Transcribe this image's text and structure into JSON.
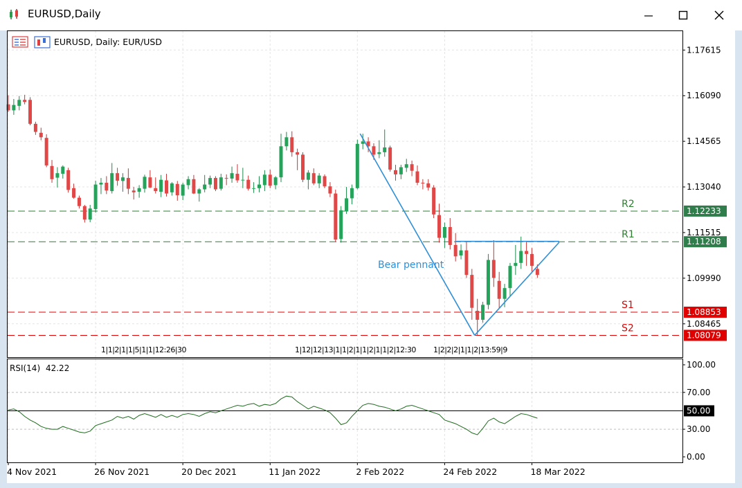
{
  "window": {
    "title": "EURUSD,Daily",
    "icon": "candlestick-app-icon",
    "controls": [
      "minimize-icon",
      "maximize-icon",
      "close-icon"
    ]
  },
  "chart_data": {
    "type": "candlestick",
    "title": "EURUSD, Daily:  EUR/USD",
    "price_axis": {
      "ticks": [
        "1.17615",
        "1.16090",
        "1.14565",
        "1.13040",
        "1.11515",
        "1.09990",
        "1.08465"
      ],
      "range": [
        1.0735,
        1.1827
      ]
    },
    "date_axis": {
      "labels": [
        {
          "text": "4 Nov 2021",
          "index": 0
        },
        {
          "text": "26 Nov 2021",
          "index": 16
        },
        {
          "text": "20 Dec 2021",
          "index": 32
        },
        {
          "text": "11 Jan 2022",
          "index": 48
        },
        {
          "text": "2 Feb 2022",
          "index": 64
        },
        {
          "text": "24 Feb 2022",
          "index": 80
        },
        {
          "text": "18 Mar 2022",
          "index": 96
        }
      ]
    },
    "levels": [
      {
        "name": "R2",
        "value": 1.12233,
        "label": "1.12233",
        "color": "#2e7d32"
      },
      {
        "name": "R1",
        "value": 1.11208,
        "label": "1.11208",
        "color": "#2e7d32"
      },
      {
        "name": "S1",
        "value": 1.08853,
        "label": "1.08853",
        "color": "#e00000"
      },
      {
        "name": "S2",
        "value": 1.08079,
        "label": "1.08079",
        "color": "#e00000"
      }
    ],
    "annotation": {
      "text": "Bear pennant",
      "color": "#2f8fd6",
      "lines": [
        {
          "from": [
            64.5,
            1.1482
          ],
          "to": [
            85.5,
            1.0808
          ]
        },
        {
          "from": [
            85.5,
            1.0808
          ],
          "to": [
            101,
            1.1119
          ]
        },
        {
          "from": [
            82,
            1.1122
          ],
          "to": [
            101,
            1.1122
          ]
        }
      ]
    },
    "event_markers": [
      "1|1|2|1|1|5|1|1|12:26|30",
      "1|12|12|13|1|1|2|1|1|2|1|1|2|12:30",
      "1|2|2|2|1|1|2|13:59|9"
    ],
    "candles": [
      [
        1.158,
        1.161,
        1.1555,
        1.156
      ],
      [
        1.156,
        1.1598,
        1.1545,
        1.1578
      ],
      [
        1.1575,
        1.1608,
        1.156,
        1.1595
      ],
      [
        1.1595,
        1.1612,
        1.158,
        1.1588
      ],
      [
        1.1595,
        1.1604,
        1.151,
        1.1515
      ],
      [
        1.1515,
        1.1522,
        1.1478,
        1.1488
      ],
      [
        1.1485,
        1.1502,
        1.146,
        1.147
      ],
      [
        1.1468,
        1.148,
        1.137,
        1.1376
      ],
      [
        1.1374,
        1.1394,
        1.1318,
        1.133
      ],
      [
        1.1335,
        1.137,
        1.1302,
        1.135
      ],
      [
        1.1348,
        1.1376,
        1.1332,
        1.1372
      ],
      [
        1.136,
        1.1368,
        1.1285,
        1.1294
      ],
      [
        1.13,
        1.1315,
        1.1265,
        1.1268
      ],
      [
        1.1268,
        1.1275,
        1.1232,
        1.124
      ],
      [
        1.124,
        1.1244,
        1.1185,
        1.1195
      ],
      [
        1.1195,
        1.1244,
        1.1186,
        1.1232
      ],
      [
        1.123,
        1.1325,
        1.1218,
        1.1312
      ],
      [
        1.1312,
        1.1334,
        1.128,
        1.1318
      ],
      [
        1.1318,
        1.134,
        1.128,
        1.1292
      ],
      [
        1.129,
        1.1384,
        1.1282,
        1.135
      ],
      [
        1.135,
        1.1368,
        1.1308,
        1.1325
      ],
      [
        1.1324,
        1.135,
        1.1288,
        1.1336
      ],
      [
        1.1334,
        1.1366,
        1.128,
        1.1298
      ],
      [
        1.1292,
        1.1304,
        1.1262,
        1.1286
      ],
      [
        1.1288,
        1.131,
        1.1268,
        1.13
      ],
      [
        1.1298,
        1.1345,
        1.1285,
        1.1338
      ],
      [
        1.1336,
        1.136,
        1.13,
        1.1302
      ],
      [
        1.13,
        1.1336,
        1.1282,
        1.129
      ],
      [
        1.1288,
        1.1344,
        1.127,
        1.1328
      ],
      [
        1.1326,
        1.1348,
        1.1272,
        1.1282
      ],
      [
        1.1286,
        1.132,
        1.1275,
        1.1316
      ],
      [
        1.1314,
        1.1324,
        1.1258,
        1.1276
      ],
      [
        1.1275,
        1.1318,
        1.126,
        1.1312
      ],
      [
        1.131,
        1.134,
        1.1296,
        1.133
      ],
      [
        1.133,
        1.1344,
        1.128,
        1.1282
      ],
      [
        1.1282,
        1.13,
        1.1255,
        1.1296
      ],
      [
        1.1296,
        1.1344,
        1.1286,
        1.1312
      ],
      [
        1.1312,
        1.1342,
        1.13,
        1.1334
      ],
      [
        1.1334,
        1.134,
        1.129,
        1.1296
      ],
      [
        1.1298,
        1.1348,
        1.1292,
        1.1336
      ],
      [
        1.1334,
        1.1346,
        1.131,
        1.1332
      ],
      [
        1.1332,
        1.1372,
        1.1318,
        1.135
      ],
      [
        1.1348,
        1.138,
        1.1318,
        1.1326
      ],
      [
        1.1326,
        1.1368,
        1.13,
        1.1328
      ],
      [
        1.1328,
        1.1342,
        1.1292,
        1.1298
      ],
      [
        1.13,
        1.132,
        1.1284,
        1.13
      ],
      [
        1.13,
        1.134,
        1.1286,
        1.1312
      ],
      [
        1.131,
        1.136,
        1.129,
        1.1345
      ],
      [
        1.1345,
        1.1362,
        1.13,
        1.1308
      ],
      [
        1.131,
        1.134,
        1.1296,
        1.1336
      ],
      [
        1.1336,
        1.1482,
        1.132,
        1.144
      ],
      [
        1.144,
        1.1488,
        1.1426,
        1.147
      ],
      [
        1.147,
        1.149,
        1.1405,
        1.142
      ],
      [
        1.142,
        1.1432,
        1.136,
        1.1412
      ],
      [
        1.1412,
        1.142,
        1.132,
        1.1328
      ],
      [
        1.1328,
        1.136,
        1.1296,
        1.1352
      ],
      [
        1.135,
        1.1366,
        1.131,
        1.1316
      ],
      [
        1.1316,
        1.135,
        1.13,
        1.1342
      ],
      [
        1.134,
        1.1346,
        1.13,
        1.1306
      ],
      [
        1.1306,
        1.132,
        1.127,
        1.1282
      ],
      [
        1.1282,
        1.1295,
        1.112,
        1.1128
      ],
      [
        1.113,
        1.124,
        1.1118,
        1.1226
      ],
      [
        1.1222,
        1.1304,
        1.1214,
        1.1266
      ],
      [
        1.1266,
        1.1312,
        1.1246,
        1.13
      ],
      [
        1.13,
        1.1462,
        1.1296,
        1.1448
      ],
      [
        1.1448,
        1.1482,
        1.143,
        1.1456
      ],
      [
        1.1456,
        1.147,
        1.142,
        1.144
      ],
      [
        1.144,
        1.145,
        1.1395,
        1.1412
      ],
      [
        1.1414,
        1.146,
        1.14,
        1.142
      ],
      [
        1.142,
        1.1496,
        1.1405,
        1.1436
      ],
      [
        1.1436,
        1.1442,
        1.1355,
        1.1362
      ],
      [
        1.136,
        1.1378,
        1.1325,
        1.1346
      ],
      [
        1.1346,
        1.1378,
        1.133,
        1.137
      ],
      [
        1.1368,
        1.1398,
        1.1354,
        1.138
      ],
      [
        1.138,
        1.1392,
        1.134,
        1.1358
      ],
      [
        1.1356,
        1.1376,
        1.131,
        1.1318
      ],
      [
        1.1318,
        1.133,
        1.1296,
        1.1316
      ],
      [
        1.1316,
        1.133,
        1.1292,
        1.1302
      ],
      [
        1.1302,
        1.131,
        1.12,
        1.1212
      ],
      [
        1.121,
        1.1248,
        1.1118,
        1.1134
      ],
      [
        1.1134,
        1.1185,
        1.11,
        1.117
      ],
      [
        1.117,
        1.12,
        1.1095,
        1.111
      ],
      [
        1.111,
        1.115,
        1.1055,
        1.1072
      ],
      [
        1.1075,
        1.1112,
        1.1062,
        1.1092
      ],
      [
        1.1092,
        1.112,
        1.1,
        1.101
      ],
      [
        1.101,
        1.103,
        1.086,
        1.09
      ],
      [
        1.089,
        1.093,
        1.0808,
        1.086
      ],
      [
        1.086,
        1.092,
        1.085,
        1.091
      ],
      [
        1.091,
        1.108,
        1.0895,
        1.106
      ],
      [
        1.106,
        1.1126,
        1.097,
        1.1
      ],
      [
        1.099,
        1.102,
        1.0898,
        1.093
      ],
      [
        1.093,
        1.098,
        1.0902,
        1.0966
      ],
      [
        1.0966,
        1.105,
        1.094,
        1.104
      ],
      [
        1.104,
        1.111,
        1.101,
        1.105
      ],
      [
        1.105,
        1.1138,
        1.103,
        1.109
      ],
      [
        1.109,
        1.112,
        1.104,
        1.108
      ],
      [
        1.108,
        1.11,
        1.102,
        1.104
      ],
      [
        1.103,
        1.1045,
        1.1,
        1.101
      ]
    ],
    "rsi": {
      "label": "RSI(14)",
      "value": "42.22",
      "ticks": [
        "100.00",
        "70.00",
        "30.00",
        "0.00"
      ],
      "midline_label": "50.00",
      "range": [
        0,
        100
      ],
      "values": [
        51,
        52,
        49,
        44,
        40,
        37,
        33,
        31,
        30,
        30,
        33,
        31,
        29,
        27,
        26,
        28,
        34,
        36,
        38,
        40,
        44,
        42,
        44,
        41,
        45,
        47,
        45,
        43,
        46,
        43,
        45,
        43,
        46,
        47,
        46,
        44,
        47,
        49,
        48,
        50,
        52,
        54,
        56,
        55,
        57,
        58,
        55,
        57,
        56,
        58,
        63,
        66,
        65,
        60,
        56,
        52,
        55,
        53,
        51,
        48,
        42,
        35,
        37,
        44,
        50,
        56,
        58,
        57,
        55,
        54,
        52,
        50,
        52,
        55,
        56,
        54,
        52,
        50,
        48,
        46,
        40,
        38,
        36,
        33,
        30,
        26,
        24,
        31,
        39,
        42,
        38,
        36,
        40,
        44,
        47,
        46,
        44,
        42
      ]
    }
  }
}
